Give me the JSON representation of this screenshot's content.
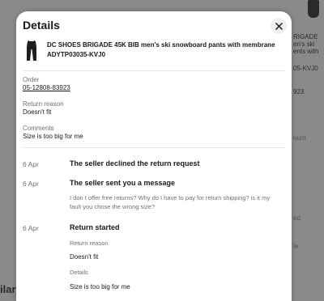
{
  "background": {
    "right_fragments": [
      "RIGADE",
      "en's ski",
      "ents with",
      "05-KVJ0",
      "923",
      "ount",
      "ed",
      "le"
    ],
    "bottom_left": "ilar"
  },
  "modal": {
    "title": "Details",
    "close_icon": "close-icon",
    "product": {
      "title": "DC SHOES BRIGADE 45K BIB men's ski snowboard pants with membrane ADYTP03035-KVJ0",
      "thumbnail_icon": "ski-pants-thumbnail"
    },
    "order": {
      "label": "Order",
      "value": "05-12808-83923"
    },
    "return_reason": {
      "label": "Return reason",
      "value": "Doesn't fit"
    },
    "comments": {
      "label": "Comments",
      "value": "Size is too big for me"
    },
    "timeline": [
      {
        "date": "6 Apr",
        "title": "The seller declined the return request"
      },
      {
        "date": "6 Apr",
        "title": "The seller sent you a message",
        "message": "I don t offer free returns? Why do I have to pay for return shipping? is it my fault you chose the wrong size?"
      },
      {
        "date": "6 Apr",
        "title": "Return started",
        "details": [
          {
            "label": "Return reason",
            "value": "Doesn't fit"
          },
          {
            "label": "Details",
            "value": "Size is too big for me"
          }
        ]
      }
    ]
  }
}
